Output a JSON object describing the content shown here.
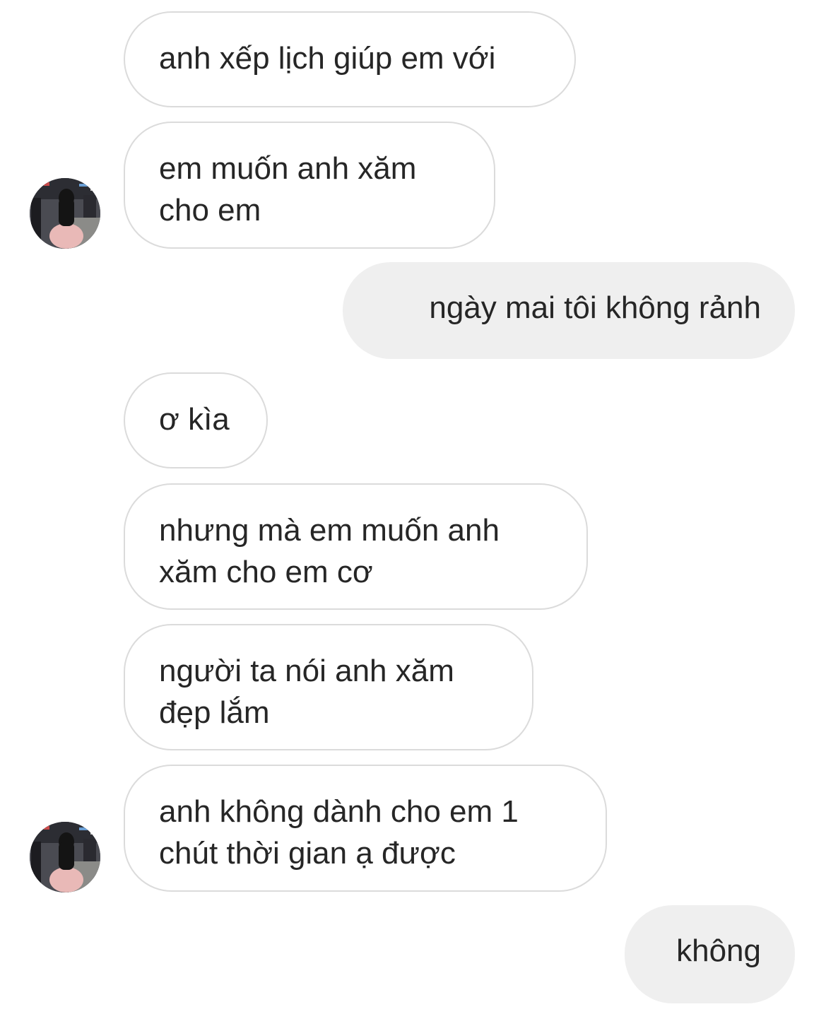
{
  "thread": {
    "messages": [
      {
        "sender": "them",
        "lines": [
          "anh xếp lịch giúp em với"
        ]
      },
      {
        "sender": "them",
        "lines": [
          "em muốn anh xăm",
          "cho em"
        ]
      },
      {
        "sender": "me",
        "lines": [
          "ngày mai tôi không rảnh"
        ]
      },
      {
        "sender": "them",
        "lines": [
          "ơ kìa"
        ]
      },
      {
        "sender": "them",
        "lines": [
          "nhưng mà em muốn anh",
          "xăm cho em cơ"
        ]
      },
      {
        "sender": "them",
        "lines": [
          "người ta nói anh xăm",
          "đẹp lắm"
        ]
      },
      {
        "sender": "them",
        "lines": [
          "anh không dành cho em 1",
          "chút thời gian ạ được"
        ]
      },
      {
        "sender": "me",
        "lines": [
          "không"
        ]
      }
    ]
  },
  "colors": {
    "incoming_bubble_bg": "#ffffff",
    "incoming_bubble_border": "#dbdbdb",
    "outgoing_bubble_bg": "#efefef",
    "text": "#262626"
  },
  "icons": {
    "avatar": "contact-avatar-photo"
  }
}
